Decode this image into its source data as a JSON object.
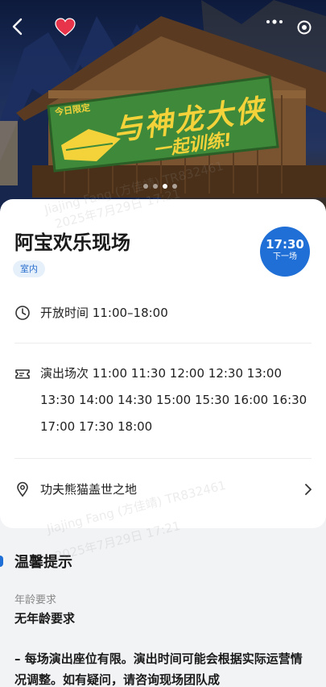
{
  "hero": {
    "sign_text_small": "今日限定",
    "sign_text_main": "与神龙大侠",
    "sign_text_sub": "一起训练!",
    "colors": {
      "sign": "#3e8a3a",
      "sign_text": "#f4d23a",
      "roof": "#6b4a2b"
    },
    "carousel": {
      "count": 4,
      "active_index": 2
    }
  },
  "topbar": {
    "back_icon": "back-arrow-icon",
    "favorite_icon": "heart-icon",
    "favorite_color": "#e8344a",
    "more_icon": "more-dots-icon",
    "target_icon": "target-icon"
  },
  "show": {
    "title": "阿宝欢乐现场",
    "tag": "室内",
    "next_time": "17:30",
    "next_label": "下一场",
    "hours_label": "开放时间",
    "hours_value": "11:00–18:00",
    "showtimes_label": "演出场次",
    "showtimes": [
      "11:00",
      "11:30",
      "12:00",
      "12:30",
      "13:00",
      "13:30",
      "14:00",
      "14:30",
      "15:00",
      "15:30",
      "16:00",
      "16:30",
      "17:00",
      "17:30",
      "18:00"
    ],
    "location": "功夫熊猫盖世之地",
    "accent": "#1f6fd6"
  },
  "tips": {
    "title": "温馨提示",
    "age_label": "年龄要求",
    "age_value": "无年龄要求",
    "notice": "– 每场演出座位有限。演出时间可能会根据实际运营情况调整。如有疑问，请咨询现场团队成"
  },
  "watermark": {
    "line1": "Jiajing Fang (方佳靖) TR832461",
    "line2": "2025年7月29日 17:21"
  }
}
